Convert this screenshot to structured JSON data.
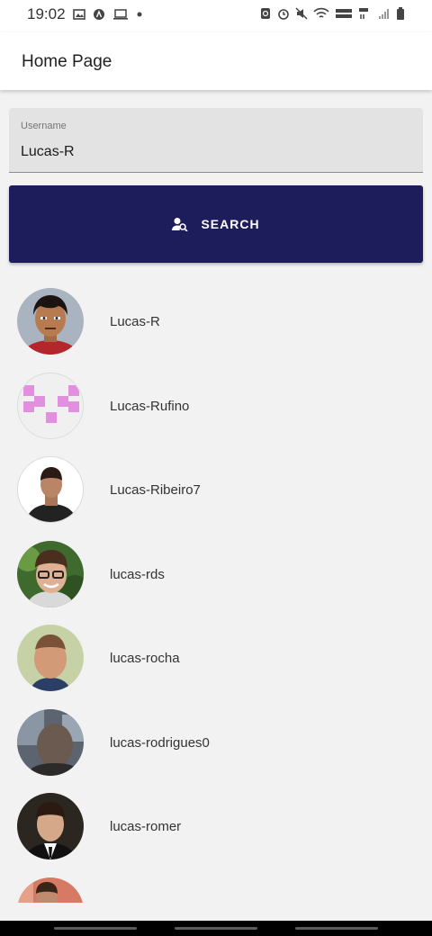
{
  "status_bar": {
    "time": "19:02"
  },
  "app_bar": {
    "title": "Home Page"
  },
  "search_field": {
    "label": "Username",
    "value": "Lucas-R"
  },
  "search_button": {
    "label": "SEARCH",
    "icon": "person-search-icon"
  },
  "users": [
    {
      "username": "Lucas-R"
    },
    {
      "username": "Lucas-Rufino"
    },
    {
      "username": "Lucas-Ribeiro7"
    },
    {
      "username": "lucas-rds"
    },
    {
      "username": "lucas-rocha"
    },
    {
      "username": "lucas-rodrigues0"
    },
    {
      "username": "lucas-romer"
    },
    {
      "username": ""
    }
  ],
  "colors": {
    "primary": "#1e1d5c",
    "background": "#f2f2f2",
    "identicon": "#e28fe0"
  }
}
